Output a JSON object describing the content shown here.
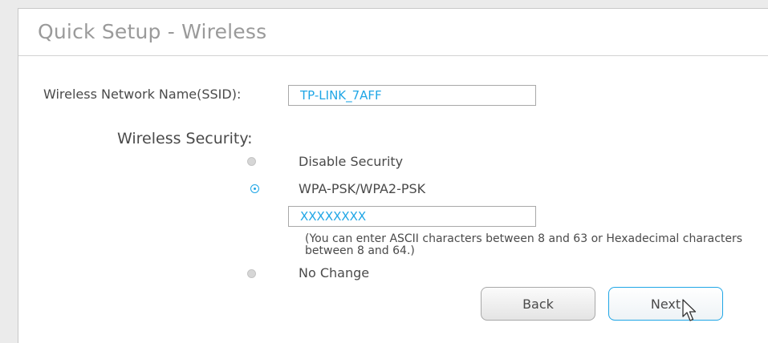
{
  "title": "Quick Setup - Wireless",
  "ssid": {
    "label": "Wireless Network Name(SSID):",
    "value": "TP-LINK_7AFF"
  },
  "security": {
    "label": "Wireless Security:",
    "options": [
      {
        "label": "Disable Security",
        "selected": false
      },
      {
        "label": "WPA-PSK/WPA2-PSK",
        "selected": true
      },
      {
        "label": "No Change",
        "selected": false
      }
    ],
    "password": "XXXXXXXX",
    "hint": "(You can enter ASCII characters between 8 and 63 or Hexadecimal characters between 8 and 64.)"
  },
  "buttons": {
    "back": "Back",
    "next": "Next"
  },
  "colors": {
    "accent": "#1fa6e6",
    "text": "#4a4a4a",
    "title": "#9a9a9a"
  },
  "icons": {
    "cursor": "mouse-pointer-icon"
  }
}
